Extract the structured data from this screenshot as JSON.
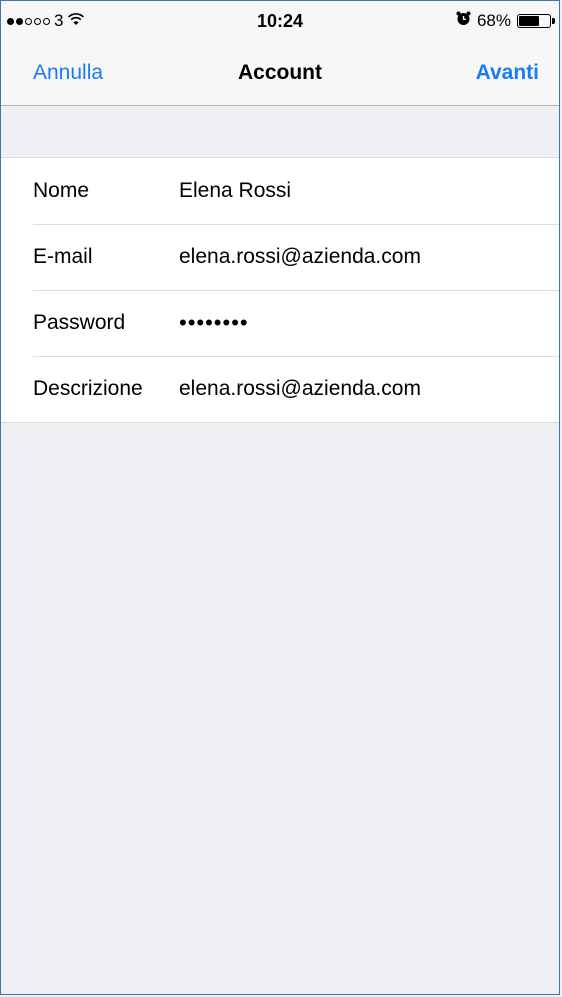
{
  "status_bar": {
    "carrier": "3",
    "signal_full": 2,
    "signal_empty": 3,
    "wifi_icon": "wifi-icon",
    "time": "10:24",
    "alarm_icon": "alarm-clock-icon",
    "battery_percent": "68%",
    "battery_level": 0.68
  },
  "nav": {
    "cancel_label": "Annulla",
    "title": "Account",
    "next_label": "Avanti",
    "accent_color": "#1a7cf5"
  },
  "form": {
    "fields": [
      {
        "label": "Nome",
        "value": "Elena Rossi"
      },
      {
        "label": "E-mail",
        "value": "elena.rossi@azienda.com"
      },
      {
        "label": "Password",
        "value": "••••••••"
      },
      {
        "label": "Descrizione",
        "value": "elena.rossi@azienda.com"
      }
    ]
  }
}
